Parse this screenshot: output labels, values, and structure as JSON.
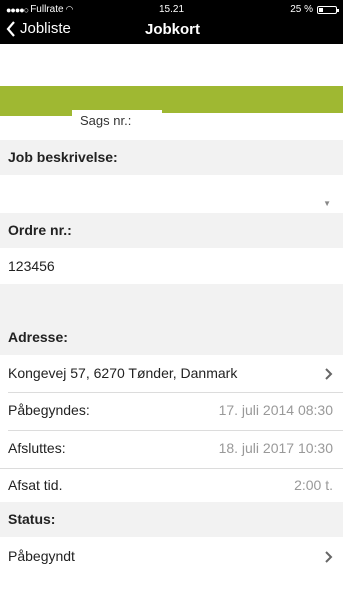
{
  "status_bar": {
    "carrier": "Fullrate",
    "time": "15.21",
    "battery_text": "25 %",
    "battery_level": 0.25
  },
  "nav": {
    "back_label": "Jobliste",
    "title": "Jobkort"
  },
  "case_number": {
    "label": "Sags nr.:",
    "value": ""
  },
  "job_description": {
    "label": "Job beskrivelse:",
    "value": ""
  },
  "order_number": {
    "label": "Ordre nr.:",
    "value": "123456"
  },
  "address": {
    "label": "Adresse:",
    "value": "Kongevej 57, 6270 Tønder, Danmark"
  },
  "started": {
    "label": "Påbegyndes:",
    "value": "17. juli 2014 08:30"
  },
  "finished": {
    "label": "Afsluttes:",
    "value": "18. juli 2017 10:30"
  },
  "time_allotted": {
    "label": "Afsat tid.",
    "value": "2:00 t."
  },
  "status": {
    "label": "Status:",
    "value": "Påbegyndt"
  },
  "colors": {
    "accent_green": "#9fb832",
    "section_gray": "#f2f2f2"
  }
}
